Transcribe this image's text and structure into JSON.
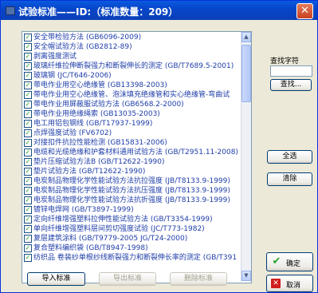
{
  "window": {
    "title": "试验标准——ID:（标准数量：209）"
  },
  "search": {
    "label": "查找字符",
    "value": "",
    "button": "查找..."
  },
  "buttons": {
    "select_all": "全选",
    "clear": "清除",
    "import": "导入标准",
    "export": "导出标准",
    "delete": "删除标准",
    "ok": "确定",
    "cancel": "取消"
  },
  "standards": [
    "安全带检验方法 (GB6096-2009)",
    "安全帽试验方法 (GB2812-89)",
    "剥离强度测试",
    "玻璃纤维拉伸断裂强力和断裂伸长的测定 (GB/T7689.5-2001)",
    "玻璃钢 (JC/T646-2006)",
    "带电作业用空心绝缘管 (GB13398-2003)",
    "带电作业用空心绝缘管、泡沫填充绝缘管和实心绝缘管-弯曲试",
    "带电作业用屏蔽服试验方法 (GB6568.2-2000)",
    "带电作业用绝缘绳索 (GB13035-2003)",
    "电工用铝包钢线 (GB/T17937-1999)",
    "点焊强度试验 (FV6702)",
    "对接扣件抗拉性能检测 (GB15831-2006)",
    "电缆和光缆绝缘和护套材料通用试验方法 (GB/T2951.11-2008)",
    "垫片压缩试验方法B (GB/T12622-1990)",
    "垫片试验方法 (GB/T12622-1990)",
    "电炭制品物理化学性能试验方法抗拉强度 (JB/T8133.9-1999)",
    "电炭制品物理化学性能试验方法抗压强度 (JB/T8133.9-1999)",
    "电炭制品物理化学性能试验方法抗折强度 (JB/T8133.9-1999)",
    "镀锌电焊网 (GB/T3897-1999)",
    "定向纤维增强塑料拉伸性能试验方法 (GB/T3354-1999)",
    "单向纤维增强塑料层间剪切强度试验 (JC/T773-1982)",
    "复层建筑涂料 (GB/T9779-2005 JG/T24-2000)",
    "复合塑料编织袋 (GB/T8947-1998)",
    "纺织品 卷装纱单根纱线断裂强力和断裂伸长率的测定 (GB/T391"
  ]
}
